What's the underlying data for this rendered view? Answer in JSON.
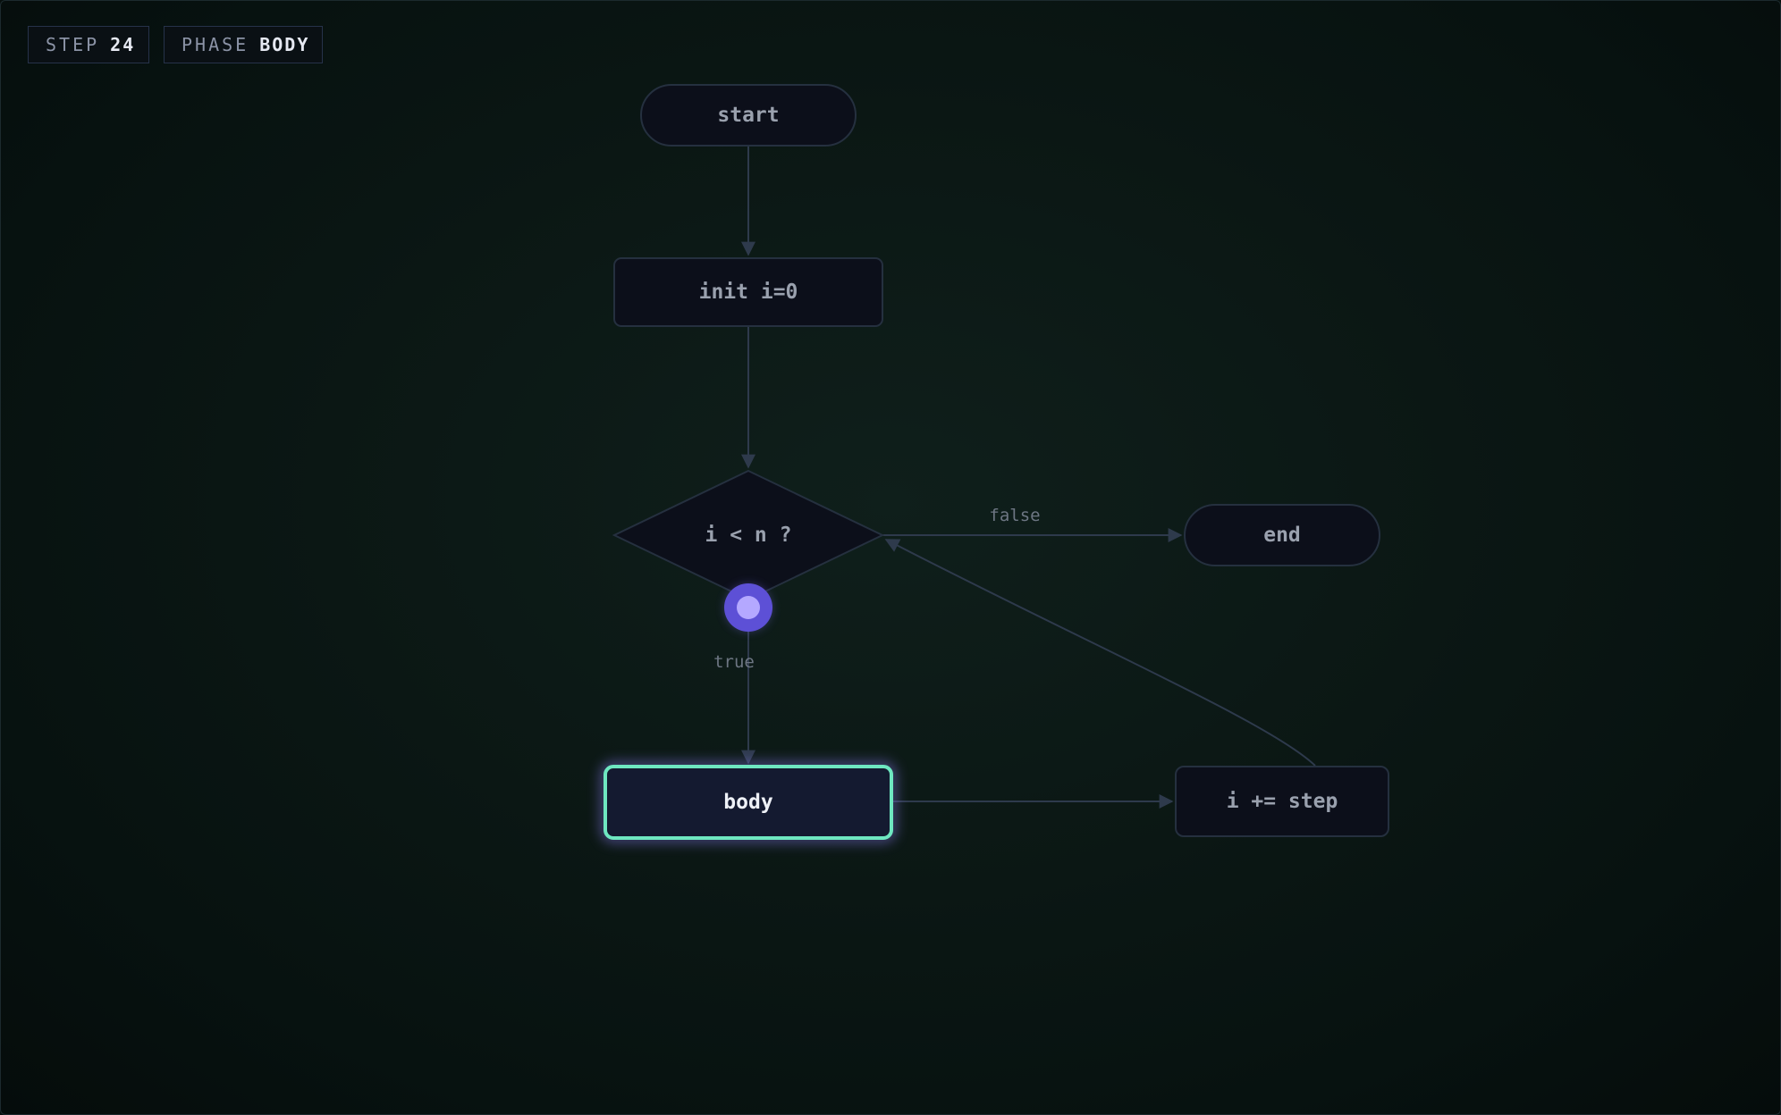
{
  "hud": {
    "step_label": "STEP",
    "step_value": "24",
    "phase_label": "PHASE",
    "phase_value": "BODY"
  },
  "flowchart": {
    "nodes": {
      "start": "start",
      "init": "init i=0",
      "condition": "i < n ?",
      "end": "end",
      "body": "body",
      "increment": "i += step"
    },
    "edge_labels": {
      "false": "false",
      "true": "true"
    },
    "active_node": "body"
  },
  "colors": {
    "background": "#0b1714",
    "node_fill": "#0c0f1a",
    "node_stroke": "#25303f",
    "edge": "#2e3a4c",
    "active_stroke": "#6ee7c0",
    "active_glow": "#8b7cf6",
    "marker": "#6b5ce0"
  }
}
